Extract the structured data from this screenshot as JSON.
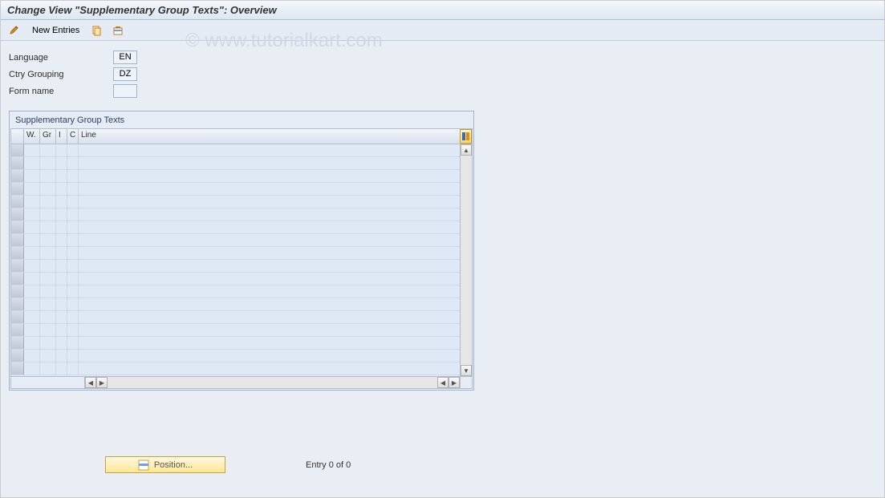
{
  "title": "Change View \"Supplementary Group Texts\": Overview",
  "toolbar": {
    "new_entries_label": "New Entries"
  },
  "watermark": "© www.tutorialkart.com",
  "form": {
    "language_label": "Language",
    "language_value": "EN",
    "ctry_label": "Ctry Grouping",
    "ctry_value": "DZ",
    "formname_label": "Form name",
    "formname_value": ""
  },
  "grid": {
    "panel_title": "Supplementary Group Texts",
    "columns": {
      "w": "W.",
      "gr": "Gr",
      "i": "I",
      "c": "C",
      "line": "Line"
    },
    "rows": [
      {},
      {},
      {},
      {},
      {},
      {},
      {},
      {},
      {},
      {},
      {},
      {},
      {},
      {},
      {},
      {},
      {},
      {}
    ],
    "position_button": "Position...",
    "entry_text": "Entry 0 of 0"
  }
}
